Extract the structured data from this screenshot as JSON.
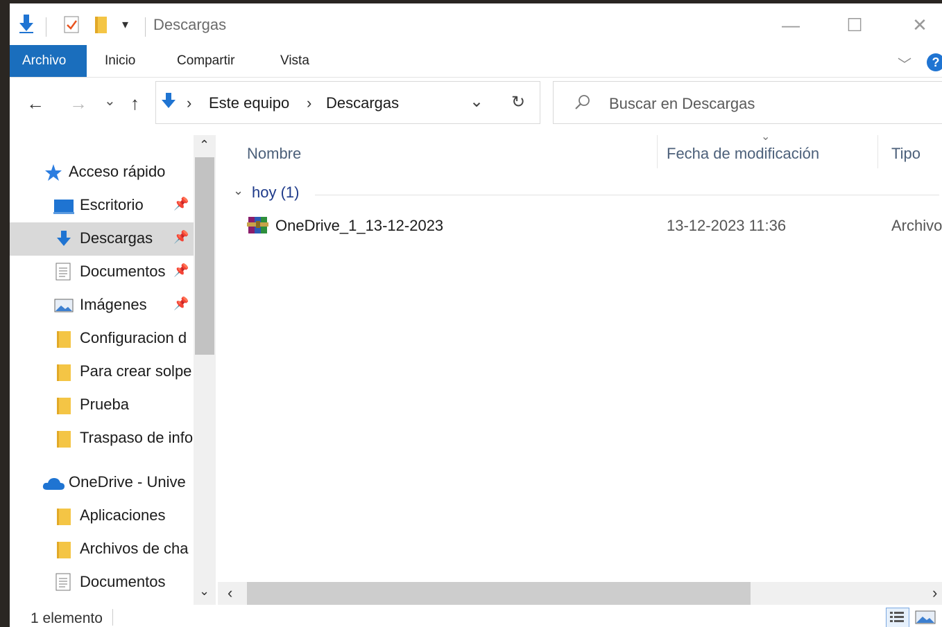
{
  "window": {
    "title": "Descargas",
    "controls": {
      "minimize": "—",
      "maximize": "☐",
      "close": "✕"
    }
  },
  "quick_access_toolbar": {
    "dropdown": "▾"
  },
  "ribbon": {
    "tabs": [
      {
        "label": "Archivo",
        "active": true
      },
      {
        "label": "Inicio"
      },
      {
        "label": "Compartir"
      },
      {
        "label": "Vista"
      }
    ],
    "collapse": "﹀",
    "help": "?"
  },
  "navigation": {
    "back": "←",
    "forward": "→",
    "recent": "⌄",
    "up": "↑",
    "breadcrumb": [
      "Este equipo",
      "Descargas"
    ],
    "separator": "›",
    "dropdown": "⌄",
    "refresh": "↻"
  },
  "search": {
    "placeholder": "Buscar en Descargas",
    "icon": "search-icon"
  },
  "sidebar": {
    "quick_access": {
      "label": "Acceso rápido",
      "icon": "star-icon"
    },
    "items": [
      {
        "label": "Escritorio",
        "icon": "desktop-icon",
        "pinned": true
      },
      {
        "label": "Descargas",
        "icon": "download-arrow-icon",
        "pinned": true,
        "selected": true
      },
      {
        "label": "Documentos",
        "icon": "document-icon",
        "pinned": true
      },
      {
        "label": "Imágenes",
        "icon": "image-icon",
        "pinned": true
      },
      {
        "label": "Configuracion d",
        "icon": "folder-icon"
      },
      {
        "label": "Para crear solpe",
        "icon": "folder-icon"
      },
      {
        "label": "Prueba",
        "icon": "folder-icon"
      },
      {
        "label": "Traspaso de info",
        "icon": "folder-icon"
      }
    ],
    "onedrive": {
      "label": "OneDrive - Unive",
      "icon": "cloud-icon"
    },
    "onedrive_items": [
      {
        "label": "Aplicaciones",
        "icon": "folder-icon"
      },
      {
        "label": "Archivos de cha",
        "icon": "folder-icon"
      },
      {
        "label": "Documentos",
        "icon": "document-icon"
      }
    ],
    "pin_glyph": "📌",
    "scroll_up": "⌃",
    "scroll_down": "⌄"
  },
  "columns": [
    "Nombre",
    "Fecha de modificación",
    "Tipo"
  ],
  "sort_indicator": "⌄",
  "group": {
    "label": "hoy (1)",
    "chevron": "⌄"
  },
  "files": [
    {
      "name": "OneDrive_1_13-12-2023",
      "modified": "13-12-2023 11:36",
      "type": "Archivo",
      "icon": "winrar-archive-icon"
    }
  ],
  "hscroll": {
    "left": "‹",
    "right": "›"
  },
  "status": {
    "count": "1 elemento"
  },
  "colors": {
    "accent": "#1a6ebd",
    "selected_bg": "#d9d9d9",
    "folder": "#f4c545",
    "header_text": "#4c607a",
    "group_text": "#1e3a8a"
  }
}
